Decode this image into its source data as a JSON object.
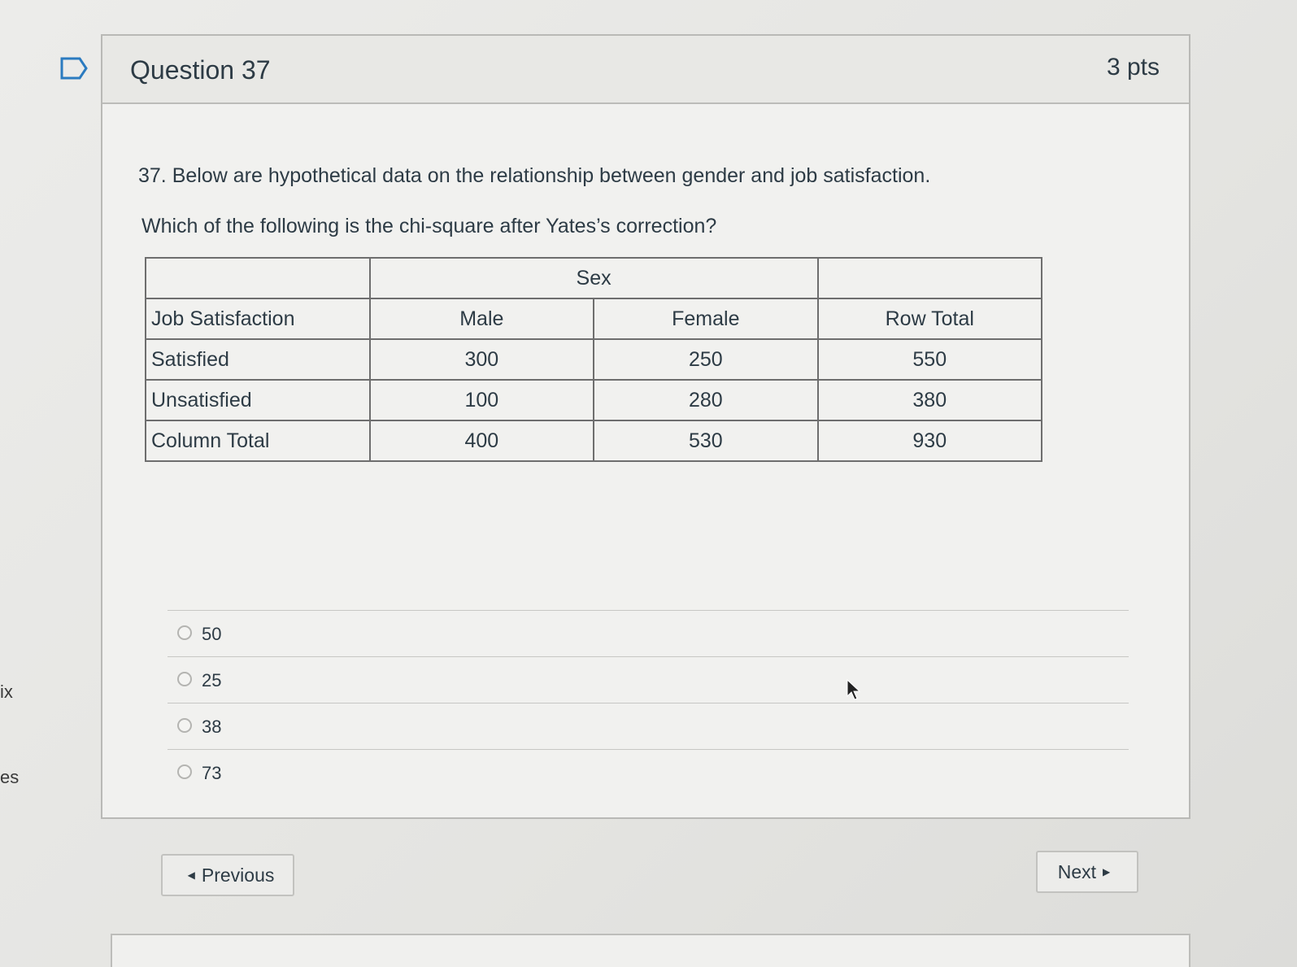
{
  "side": {
    "text_1": "ix",
    "text_2": "es"
  },
  "question": {
    "title": "Question 37",
    "points": "3 pts",
    "prompt_line_1": "37. Below are hypothetical data on the relationship between gender and job satisfaction.",
    "prompt_line_2": "Which of the following is the chi-square after Yates’s correction?"
  },
  "table": {
    "group_header": "Sex",
    "columns": [
      "Job Satisfaction",
      "Male",
      "Female",
      "Row Total"
    ],
    "rows": [
      [
        "Satisfied",
        "300",
        "250",
        "550"
      ],
      [
        "Unsatisfied",
        "100",
        "280",
        "380"
      ],
      [
        "Column Total",
        "400",
        "530",
        "930"
      ]
    ]
  },
  "answers": [
    "50",
    "25",
    "38",
    "73"
  ],
  "nav": {
    "previous_label": "Previous",
    "next_label": "Next"
  },
  "icons": {
    "flag": "flag-icon",
    "prev_caret": "caret-left-icon",
    "next_caret": "caret-right-icon",
    "cursor": "mouse-pointer-icon"
  }
}
